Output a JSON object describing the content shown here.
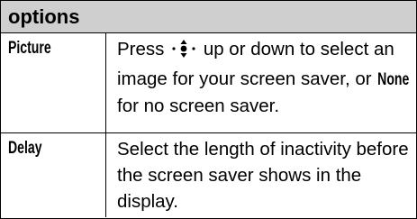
{
  "table": {
    "header": "options",
    "rows": [
      {
        "term": "Picture",
        "desc_part1": "Press",
        "icon": "nav-key-icon",
        "desc_part2": "up or down to select an image for your screen saver, or",
        "inline_term": "None",
        "desc_part3": "for no screen saver."
      },
      {
        "term": "Delay",
        "desc": "Select the length of inactivity before the screen saver shows in the display."
      }
    ]
  }
}
